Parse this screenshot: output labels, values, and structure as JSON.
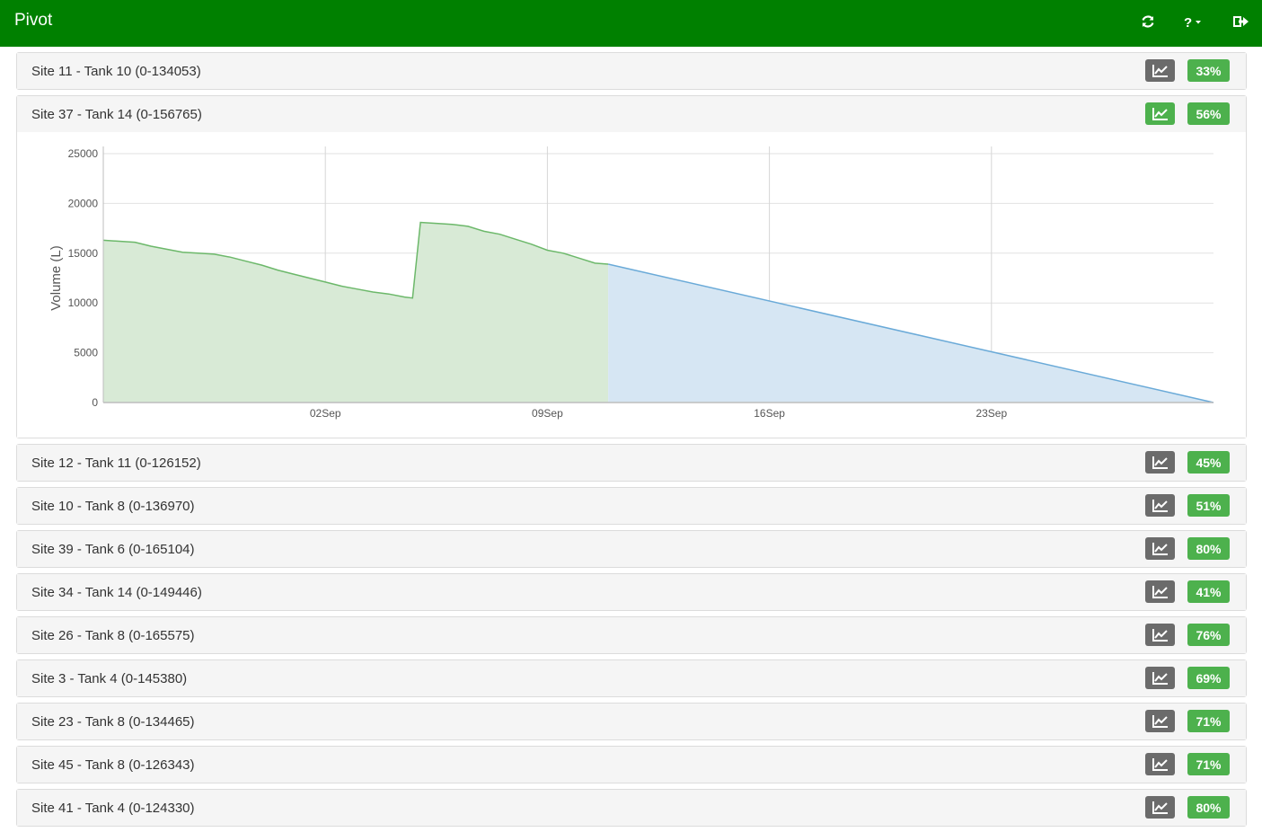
{
  "app": {
    "title": "Pivot",
    "icons": {
      "refresh": "refresh-icon",
      "help": "question-icon",
      "help_caret": "caret-down-icon",
      "logout": "sign-out-icon"
    }
  },
  "colors": {
    "navbar": "#008000",
    "badge": "#4db14d",
    "chart_button": "#6b6b6b",
    "history_fill": "#d8ead6",
    "history_line": "#6cb86a",
    "forecast_fill": "#d6e6f3",
    "forecast_line": "#6aaad8"
  },
  "tanks": [
    {
      "label": "Site 11 - Tank 10 (0-134053)",
      "level": "33%",
      "expanded": false
    },
    {
      "label": "Site 37 - Tank 14 (0-156765)",
      "level": "56%",
      "expanded": true
    },
    {
      "label": "Site 12 - Tank 11 (0-126152)",
      "level": "45%",
      "expanded": false
    },
    {
      "label": "Site 10 - Tank 8 (0-136970)",
      "level": "51%",
      "expanded": false
    },
    {
      "label": "Site 39 - Tank 6 (0-165104)",
      "level": "80%",
      "expanded": false
    },
    {
      "label": "Site 34 - Tank 14 (0-149446)",
      "level": "41%",
      "expanded": false
    },
    {
      "label": "Site 26 - Tank 8 (0-165575)",
      "level": "76%",
      "expanded": false
    },
    {
      "label": "Site 3 - Tank 4 (0-145380)",
      "level": "69%",
      "expanded": false
    },
    {
      "label": "Site 23 - Tank 8 (0-134465)",
      "level": "71%",
      "expanded": false
    },
    {
      "label": "Site 45 - Tank 8 (0-126343)",
      "level": "71%",
      "expanded": false
    },
    {
      "label": "Site 41 - Tank 4 (0-124330)",
      "level": "80%",
      "expanded": false
    }
  ],
  "chart_data": {
    "type": "area",
    "title": "",
    "ylabel": "Volume (L)",
    "xlabel": "",
    "ylim": [
      0,
      25000
    ],
    "yticks": [
      0,
      5000,
      10000,
      15000,
      20000,
      25000
    ],
    "xlim": [
      "2021-08-26",
      "2021-09-30"
    ],
    "xticks": [
      {
        "date": "2021-09-02",
        "label": "02Sep"
      },
      {
        "date": "2021-09-09",
        "label": "09Sep"
      },
      {
        "date": "2021-09-16",
        "label": "16Sep"
      },
      {
        "date": "2021-09-23",
        "label": "23Sep"
      }
    ],
    "grid": true,
    "series": [
      {
        "type": "history",
        "points": [
          [
            "2021-08-26",
            16300
          ],
          [
            "2021-08-26T12:00",
            16200
          ],
          [
            "2021-08-27",
            16100
          ],
          [
            "2021-08-27T12:00",
            15700
          ],
          [
            "2021-08-28",
            15400
          ],
          [
            "2021-08-28T12:00",
            15100
          ],
          [
            "2021-08-29",
            15000
          ],
          [
            "2021-08-29T12:00",
            14900
          ],
          [
            "2021-08-30",
            14600
          ],
          [
            "2021-08-30T12:00",
            14200
          ],
          [
            "2021-08-31",
            13800
          ],
          [
            "2021-08-31T12:00",
            13300
          ],
          [
            "2021-09-01",
            12900
          ],
          [
            "2021-09-01T12:00",
            12500
          ],
          [
            "2021-09-02",
            12100
          ],
          [
            "2021-09-02T12:00",
            11700
          ],
          [
            "2021-09-03",
            11400
          ],
          [
            "2021-09-03T12:00",
            11100
          ],
          [
            "2021-09-04",
            10900
          ],
          [
            "2021-09-04T12:00",
            10600
          ],
          [
            "2021-09-04T18:00",
            10500
          ],
          [
            "2021-09-05",
            18100
          ],
          [
            "2021-09-05T12:00",
            18000
          ],
          [
            "2021-09-06",
            17900
          ],
          [
            "2021-09-06T12:00",
            17700
          ],
          [
            "2021-09-07",
            17200
          ],
          [
            "2021-09-07T12:00",
            16900
          ],
          [
            "2021-09-08",
            16400
          ],
          [
            "2021-09-08T12:00",
            15900
          ],
          [
            "2021-09-09",
            15300
          ],
          [
            "2021-09-09T12:00",
            15000
          ],
          [
            "2021-09-10",
            14500
          ],
          [
            "2021-09-10T12:00",
            14000
          ],
          [
            "2021-09-10T22:00",
            13900
          ]
        ]
      },
      {
        "type": "forecast",
        "points": [
          [
            "2021-09-10T22:00",
            13900
          ],
          [
            "2021-09-30",
            0
          ]
        ]
      }
    ]
  }
}
